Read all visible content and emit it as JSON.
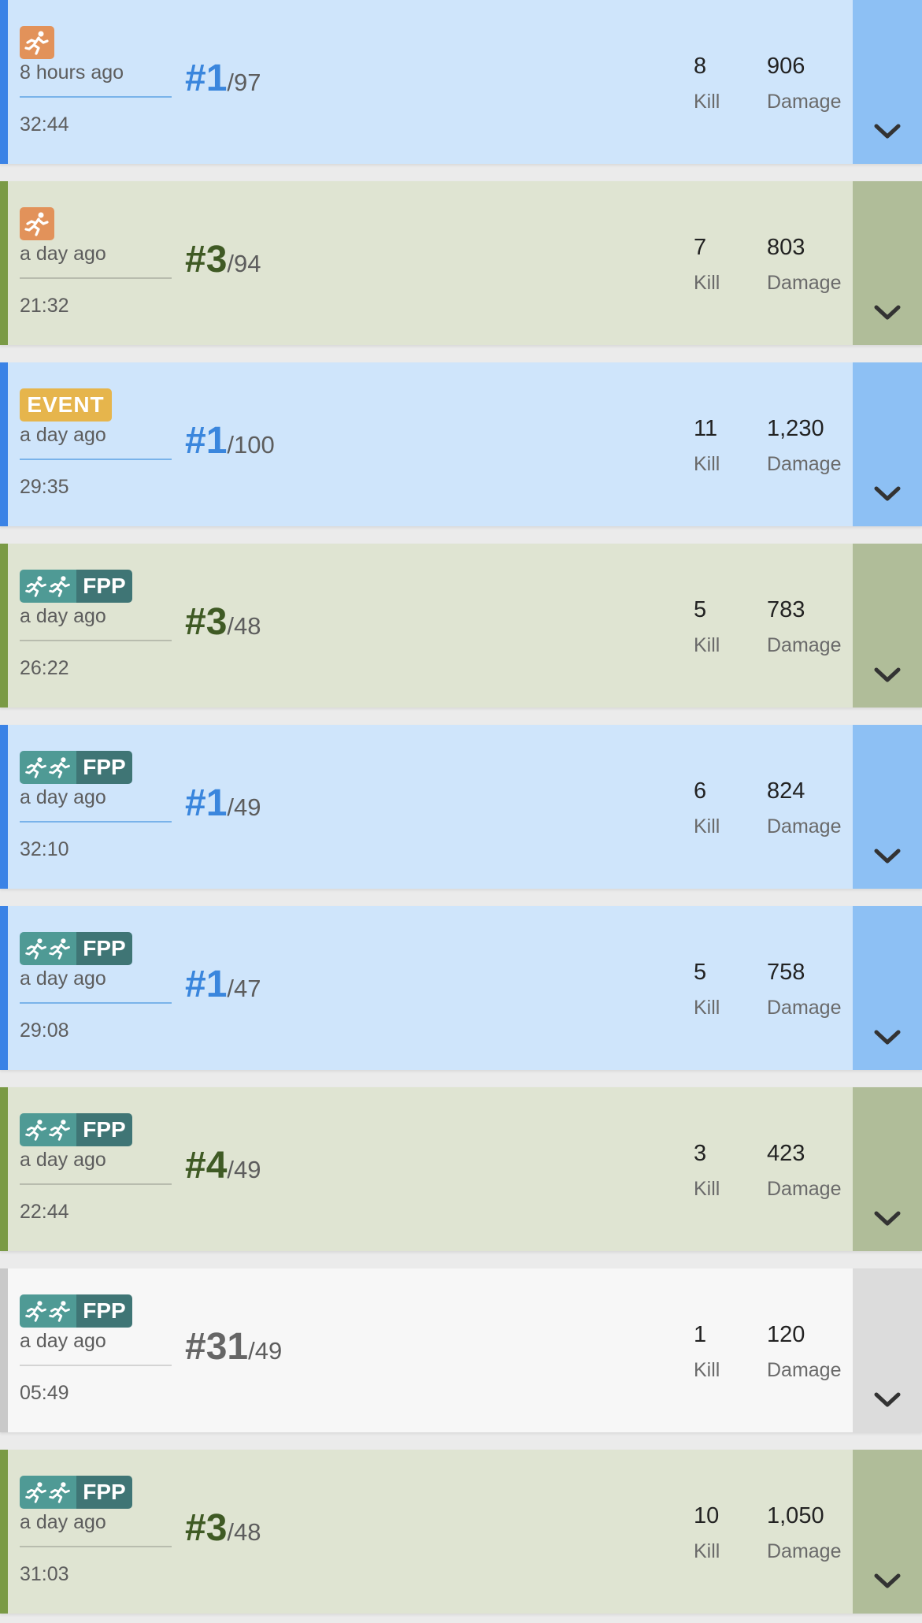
{
  "ui": {
    "kill_label": "Kill",
    "damage_label": "Damage",
    "fpp_label": "FPP",
    "event_label": "EVENT"
  },
  "matches": [
    {
      "result": "win",
      "mode": "solo",
      "ago": "8 hours ago",
      "duration": "32:44",
      "rank": "#1",
      "total": "/97",
      "kills": "8",
      "damage": "906"
    },
    {
      "result": "top",
      "mode": "solo",
      "ago": "a day ago",
      "duration": "21:32",
      "rank": "#3",
      "total": "/94",
      "kills": "7",
      "damage": "803"
    },
    {
      "result": "win",
      "mode": "event",
      "ago": "a day ago",
      "duration": "29:35",
      "rank": "#1",
      "total": "/100",
      "kills": "11",
      "damage": "1,230"
    },
    {
      "result": "top",
      "mode": "duo",
      "ago": "a day ago",
      "duration": "26:22",
      "rank": "#3",
      "total": "/48",
      "kills": "5",
      "damage": "783"
    },
    {
      "result": "win",
      "mode": "duo",
      "ago": "a day ago",
      "duration": "32:10",
      "rank": "#1",
      "total": "/49",
      "kills": "6",
      "damage": "824"
    },
    {
      "result": "win",
      "mode": "duo",
      "ago": "a day ago",
      "duration": "29:08",
      "rank": "#1",
      "total": "/47",
      "kills": "5",
      "damage": "758"
    },
    {
      "result": "top",
      "mode": "duo",
      "ago": "a day ago",
      "duration": "22:44",
      "rank": "#4",
      "total": "/49",
      "kills": "3",
      "damage": "423"
    },
    {
      "result": "lose",
      "mode": "duo",
      "ago": "a day ago",
      "duration": "05:49",
      "rank": "#31",
      "total": "/49",
      "kills": "1",
      "damage": "120"
    },
    {
      "result": "top",
      "mode": "duo",
      "ago": "a day ago",
      "duration": "31:03",
      "rank": "#3",
      "total": "/48",
      "kills": "10",
      "damage": "1,050"
    }
  ],
  "colors": {
    "win_accent": "#3b83e6",
    "win_background": "#cfe5fb",
    "top_accent": "#7a9a45",
    "top_background": "#dfe4d2",
    "lose_background": "#f7f7f7",
    "solo_badge": "#e2925a",
    "event_badge": "#e6b54c",
    "duo_badge": "#4f9a95"
  }
}
